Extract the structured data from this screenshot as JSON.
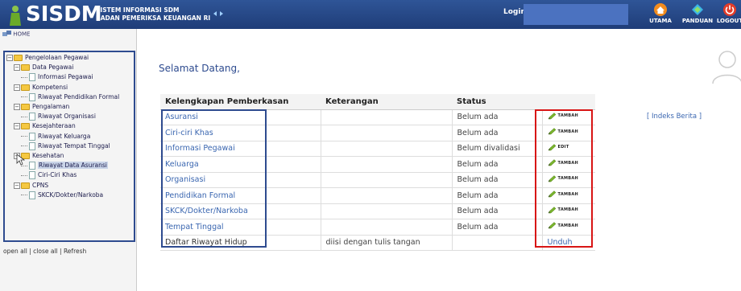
{
  "header": {
    "brand": "SISDM",
    "subtitle_line1": "SISTEM INFORMASI SDM",
    "subtitle_line2": "BADAN PEMERIKSA KEUANGAN RI",
    "login_label": "Login:",
    "login_value": "",
    "toolbar": [
      {
        "label": "UTAMA",
        "icon": "home-icon",
        "color": "#f28c1e"
      },
      {
        "label": "PANDUAN",
        "icon": "book-icon",
        "color": "#3ab4e8"
      },
      {
        "label": "LOGOUT",
        "icon": "power-icon",
        "color": "#e33c2a"
      }
    ]
  },
  "sidebar": {
    "home": "HOME",
    "tree": [
      {
        "label": "Pengelolaan Pegawai",
        "level": 0,
        "type": "folder"
      },
      {
        "label": "Data Pegawai",
        "level": 1,
        "type": "folder"
      },
      {
        "label": "Informasi Pegawai",
        "level": 2,
        "type": "page"
      },
      {
        "label": "Kompetensi",
        "level": 1,
        "type": "folder"
      },
      {
        "label": "Riwayat Pendidikan Formal",
        "level": 2,
        "type": "page"
      },
      {
        "label": "Pengalaman",
        "level": 1,
        "type": "folder"
      },
      {
        "label": "Riwayat Organisasi",
        "level": 2,
        "type": "page"
      },
      {
        "label": "Kesejahteraan",
        "level": 1,
        "type": "folder"
      },
      {
        "label": "Riwayat Keluarga",
        "level": 2,
        "type": "page"
      },
      {
        "label": "Riwayat Tempat Tinggal",
        "level": 2,
        "type": "page"
      },
      {
        "label": "Kesehatan",
        "level": 1,
        "type": "folder"
      },
      {
        "label": "Riwayat Data Asuransi",
        "level": 2,
        "type": "page",
        "selected": true
      },
      {
        "label": "Ciri-Ciri Khas",
        "level": 2,
        "type": "page"
      },
      {
        "label": "CPNS",
        "level": 1,
        "type": "folder"
      },
      {
        "label": "SKCK/Dokter/Narkoba",
        "level": 2,
        "type": "page"
      }
    ],
    "links": {
      "open_all": "open all",
      "close_all": "close all",
      "refresh": "Refresh",
      "sep": " | "
    }
  },
  "main": {
    "welcome": "Selamat Datang,",
    "indeks": "[ Indeks Berita ]",
    "table": {
      "headers": [
        "Kelengkapan Pemberkasan",
        "Keterangan",
        "Status",
        ""
      ],
      "rows": [
        {
          "name": "Asuransi",
          "keterangan": "",
          "status": "Belum ada",
          "action": "TAMBAH"
        },
        {
          "name": "Ciri-ciri Khas",
          "keterangan": "",
          "status": "Belum ada",
          "action": "TAMBAH"
        },
        {
          "name": "Informasi Pegawai",
          "keterangan": "",
          "status": "Belum divalidasi",
          "action": "EDIT"
        },
        {
          "name": "Keluarga",
          "keterangan": "",
          "status": "Belum ada",
          "action": "TAMBAH"
        },
        {
          "name": "Organisasi",
          "keterangan": "",
          "status": "Belum ada",
          "action": "TAMBAH"
        },
        {
          "name": "Pendidikan Formal",
          "keterangan": "",
          "status": "Belum ada",
          "action": "TAMBAH"
        },
        {
          "name": "SKCK/Dokter/Narkoba",
          "keterangan": "",
          "status": "Belum ada",
          "action": "TAMBAH"
        },
        {
          "name": "Tempat Tinggal",
          "keterangan": "",
          "status": "Belum ada",
          "action": "TAMBAH"
        }
      ],
      "footer": {
        "name": "Daftar Riwayat Hidup",
        "keterangan": "diisi dengan tulis tangan",
        "status": "",
        "action": "Unduh"
      }
    }
  },
  "colors": {
    "header_bg": "#2f5597",
    "link": "#3a66b0",
    "highlight_red": "#d81515",
    "highlight_blue": "#2e4b8f"
  }
}
